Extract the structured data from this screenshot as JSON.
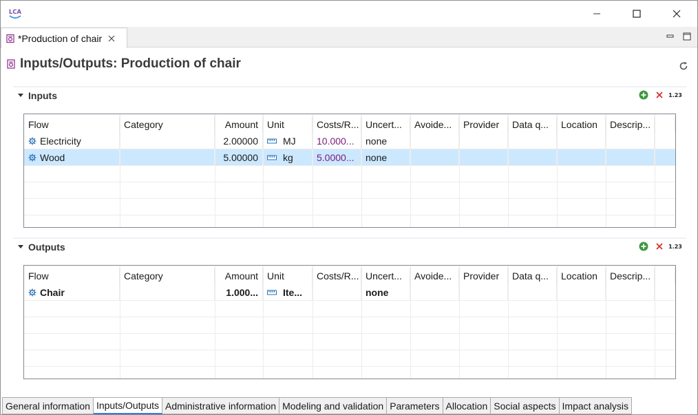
{
  "app": {
    "logo_text": "LCA"
  },
  "editor_tab": {
    "label": "*Production of chair"
  },
  "page": {
    "title": "Inputs/Outputs: Production of chair"
  },
  "columns": [
    "Flow",
    "Category",
    "Amount",
    "Unit",
    "Costs/R...",
    "Uncert...",
    "Avoide...",
    "Provider",
    "Data q...",
    "Location",
    "Descrip..."
  ],
  "inputs": {
    "title": "Inputs",
    "rows": [
      {
        "flow": "Electricity",
        "category": "",
        "amount": "2.00000",
        "unit": "MJ",
        "costs": "10.000...",
        "uncertainty": "none",
        "selected": false
      },
      {
        "flow": "Wood",
        "category": "",
        "amount": "5.00000",
        "unit": "kg",
        "costs": "5.0000...",
        "uncertainty": "none",
        "selected": true
      }
    ]
  },
  "outputs": {
    "title": "Outputs",
    "rows": [
      {
        "flow": "Chair",
        "category": "",
        "amount": "1.000...",
        "unit": "Ite...",
        "costs": "",
        "uncertainty": "none",
        "bold": true
      }
    ]
  },
  "toolbar": {
    "format_label": "1.23"
  },
  "bottom_tabs": [
    {
      "label": "General information",
      "active": false
    },
    {
      "label": "Inputs/Outputs",
      "active": true
    },
    {
      "label": "Administrative information",
      "active": false
    },
    {
      "label": "Modeling and validation",
      "active": false
    },
    {
      "label": "Parameters",
      "active": false
    },
    {
      "label": "Allocation",
      "active": false
    },
    {
      "label": "Social aspects",
      "active": false
    },
    {
      "label": "Impact analysis",
      "active": false
    }
  ],
  "colors": {
    "accent_blue": "#3a7bd5",
    "selection": "#cce8ff",
    "cost_purple": "#7b1a7f",
    "add_green": "#3c9a3c",
    "remove_red": "#d9302c"
  },
  "icons": {
    "flow": "gear-icon",
    "unit": "ruler-icon",
    "process": "process-icon",
    "add": "plus-circle-icon",
    "remove": "x-icon",
    "refresh": "refresh-icon"
  }
}
